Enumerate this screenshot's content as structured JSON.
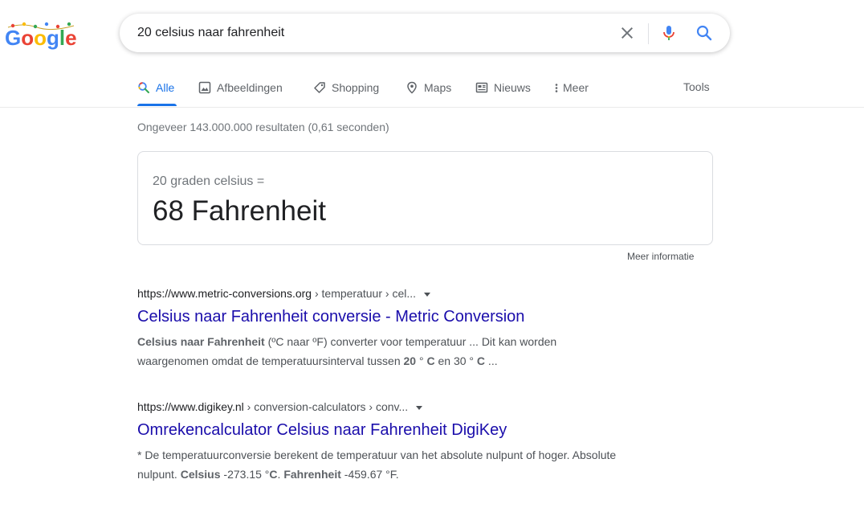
{
  "colors": {
    "accent": "#1a73e8",
    "link": "#1a0dab",
    "muted": "#70757a"
  },
  "logo": {
    "text": "Google"
  },
  "search": {
    "query": "20 celsius naar fahrenheit",
    "clear_icon": "close-icon",
    "mic_icon": "mic-icon",
    "search_icon": "search-icon"
  },
  "tabs": [
    {
      "label": "Alle",
      "icon": "search-icon",
      "active": true
    },
    {
      "label": "Afbeeldingen",
      "icon": "image-icon"
    },
    {
      "label": "Shopping",
      "icon": "tag-icon"
    },
    {
      "label": "Maps",
      "icon": "map-pin-icon"
    },
    {
      "label": "Nieuws",
      "icon": "news-icon"
    },
    {
      "label": "Meer",
      "icon": "more-vert-icon"
    }
  ],
  "tools_label": "Tools",
  "stats": "Ongeveer 143.000.000 resultaten (0,61 seconden)",
  "converter": {
    "question": "20 graden celsius =",
    "answer": "68 Fahrenheit",
    "more_info": "Meer informatie"
  },
  "results": [
    {
      "domain": "https://www.metric-conversions.org",
      "crumbs": " › temperatuur › cel...",
      "title": "Celsius naar Fahrenheit conversie - Metric Conversion",
      "snippet_line1_parts": [
        "Celsius naar Fahrenheit",
        " (ºC naar ºF) converter voor temperatuur ... Dit kan worden"
      ],
      "snippet_line2_parts": [
        "waargenomen omdat de temperatuursinterval tussen ",
        "20",
        " ° ",
        "C",
        " en 30 ° ",
        "C",
        " ..."
      ]
    },
    {
      "domain": "https://www.digikey.nl",
      "crumbs": " › conversion-calculators › conv...",
      "title": "Omrekencalculator Celsius naar Fahrenheit DigiKey",
      "snippet_line1_parts": [
        "* De temperatuurconversie berekent de temperatuur van het absolute nulpunt of hoger. Absolute"
      ],
      "snippet_line2_parts": [
        "nulpunt. ",
        "Celsius",
        " -273.15 °",
        "C",
        ". ",
        "Fahrenheit",
        " -459.67 °F."
      ]
    }
  ]
}
